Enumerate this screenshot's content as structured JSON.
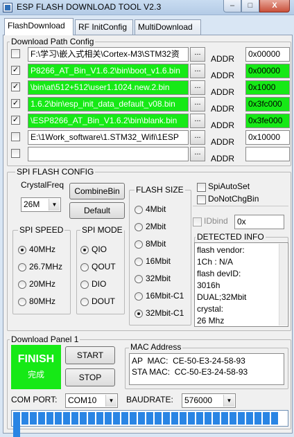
{
  "window": {
    "title": "ESP FLASH DOWNLOAD TOOL V2.3",
    "min_glyph": "–",
    "max_glyph": "□",
    "close_glyph": "X"
  },
  "tabs": [
    "FlashDownload",
    "RF InitConfig",
    "MultiDownload"
  ],
  "download_path": {
    "legend": "Download Path Config",
    "rows": [
      {
        "checked": true,
        "check_glyph": "",
        "path": "F:\\学习\\嵌入式相关\\Cortex-M3\\STM32资",
        "highlight": false,
        "addr": "0x00000",
        "addr_highlight": false
      },
      {
        "checked": true,
        "check_glyph": "✓",
        "path": "P8266_AT_Bin_V1.6.2\\bin\\boot_v1.6.bin",
        "highlight": true,
        "addr": "0x00000",
        "addr_highlight": true
      },
      {
        "checked": true,
        "check_glyph": "✓",
        "path": "\\bin\\at\\512+512\\user1.1024.new.2.bin",
        "highlight": true,
        "addr": "0x1000",
        "addr_highlight": true
      },
      {
        "checked": true,
        "check_glyph": "✓",
        "path": "1.6.2\\bin\\esp_init_data_default_v08.bin",
        "highlight": true,
        "addr": "0x3fc000",
        "addr_highlight": true
      },
      {
        "checked": true,
        "check_glyph": "✓",
        "path": "\\ESP8266_AT_Bin_V1.6.2\\bin\\blank.bin",
        "highlight": true,
        "addr": "0x3fe000",
        "addr_highlight": true
      },
      {
        "checked": false,
        "check_glyph": "",
        "path": "E:\\1Work_software\\1.STM32_Wifi\\1ESP",
        "highlight": false,
        "addr": "0x10000",
        "addr_highlight": false
      },
      {
        "checked": false,
        "check_glyph": "",
        "path": "",
        "highlight": false,
        "addr": "",
        "addr_highlight": false
      }
    ],
    "dots_label": "...",
    "addr_label": "ADDR"
  },
  "spi_config": {
    "legend": "SPI FLASH CONFIG",
    "crystal_label": "CrystalFreq",
    "crystal_value": "26M",
    "combine_label": "CombineBin",
    "default_label": "Default",
    "spi_speed": {
      "legend": "SPI SPEED",
      "options": [
        "40MHz",
        "26.7MHz",
        "20MHz",
        "80MHz"
      ],
      "selected": "40MHz"
    },
    "spi_mode": {
      "legend": "SPI MODE",
      "options": [
        "QIO",
        "QOUT",
        "DIO",
        "DOUT"
      ],
      "selected": "QIO"
    },
    "flash_size": {
      "legend": "FLASH SIZE",
      "options": [
        "4Mbit",
        "2Mbit",
        "8Mbit",
        "16Mbit",
        "32Mbit",
        "16Mbit-C1",
        "32Mbit-C1"
      ],
      "selected": "32Mbit-C1"
    },
    "spi_auto_set": "SpiAutoSet",
    "do_not_chg_bin": "DoNotChgBin",
    "idbind_label": "IDbind",
    "idbind_value": "0x",
    "detected": {
      "legend": "DETECTED INFO",
      "lines": [
        "flash vendor:",
        "1Ch : N/A",
        "flash devID:",
        "3016h",
        "DUAL;32Mbit",
        "crystal:",
        "26 Mhz"
      ]
    }
  },
  "download_panel": {
    "legend": "Download Panel 1",
    "status": "FINISH",
    "status_sub": "完成",
    "status_color": "#16e916",
    "start_label": "START",
    "stop_label": "STOP",
    "mac": {
      "legend": "MAC Address",
      "ap": "AP  MAC:  CE-50-E3-24-58-93",
      "sta": "STA MAC:  CC-50-E3-24-58-93"
    },
    "com_label": "COM PORT:",
    "com_value": "COM10",
    "baud_label": "BAUDRATE:",
    "baud_value": "576000",
    "progress_fraction": 1.0,
    "progress_color": "#2a85e4"
  }
}
